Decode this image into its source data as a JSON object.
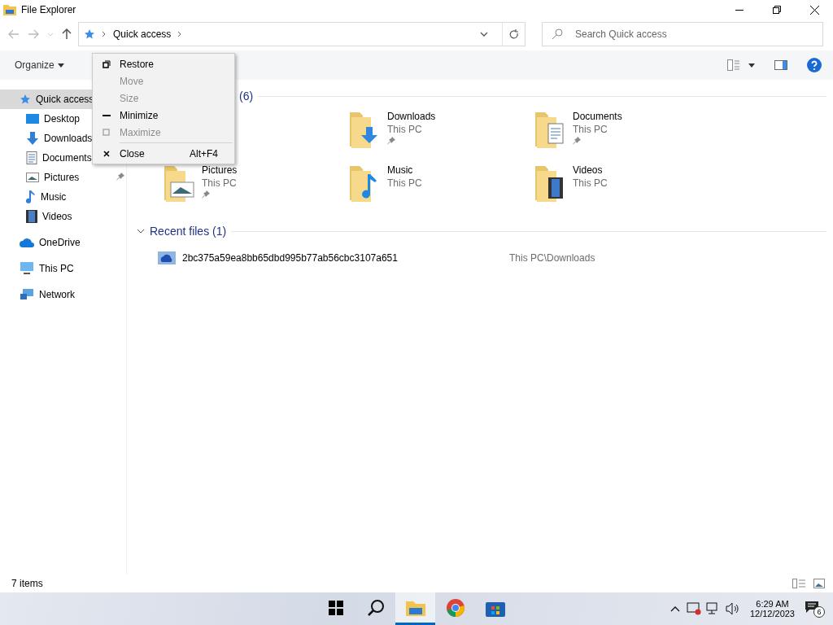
{
  "window": {
    "title": "File Explorer"
  },
  "address": {
    "segments": [
      "Quick access"
    ]
  },
  "search": {
    "placeholder": "Search Quick access"
  },
  "command_bar": {
    "organize": "Organize"
  },
  "sidebar": {
    "items": [
      {
        "label": "Quick access",
        "kind": "star",
        "selected": true,
        "children": [
          {
            "label": "Desktop",
            "kind": "desktop",
            "selected": false
          },
          {
            "label": "Downloads",
            "kind": "downloads",
            "selected": false
          },
          {
            "label": "Documents",
            "kind": "documents",
            "selected": false
          },
          {
            "label": "Pictures",
            "kind": "pictures",
            "selected": false,
            "pinned": true
          },
          {
            "label": "Music",
            "kind": "music",
            "selected": false
          },
          {
            "label": "Videos",
            "kind": "videos",
            "selected": false
          }
        ]
      },
      {
        "label": "OneDrive",
        "kind": "cloud",
        "selected": false
      },
      {
        "label": "This PC",
        "kind": "pc",
        "selected": false
      },
      {
        "label": "Network",
        "kind": "network",
        "selected": false
      }
    ]
  },
  "frequent_folders": {
    "header": "(6)",
    "folders": [
      {
        "name": "Downloads",
        "location": "This PC",
        "kind": "downloads",
        "pinned": true
      },
      {
        "name": "Documents",
        "location": "This PC",
        "kind": "documents",
        "pinned": true
      },
      {
        "name": "Pictures",
        "location": "This PC",
        "kind": "pictures",
        "pinned": true
      },
      {
        "name": "Music",
        "location": "This PC",
        "kind": "music",
        "pinned": false
      },
      {
        "name": "Videos",
        "location": "This PC",
        "kind": "videos",
        "pinned": false
      }
    ]
  },
  "recent_files": {
    "header": "Recent files (1)",
    "files": [
      {
        "name": "2bc375a59ea8bb65dbd995b77ab56cbc3107a651",
        "location": "This PC\\Downloads"
      }
    ]
  },
  "context_menu": {
    "items": [
      {
        "label": "Restore",
        "kind": "restore",
        "disabled": false
      },
      {
        "label": "Move",
        "kind": "none",
        "disabled": true
      },
      {
        "label": "Size",
        "kind": "none",
        "disabled": true
      },
      {
        "label": "Minimize",
        "kind": "minimize",
        "disabled": false
      },
      {
        "label": "Maximize",
        "kind": "maximize",
        "disabled": true
      },
      {
        "label": "Close",
        "kind": "close",
        "disabled": false,
        "shortcut": "Alt+F4"
      }
    ]
  },
  "status_bar": {
    "items": "7 items"
  },
  "taskbar": {
    "apps": [
      {
        "kind": "start",
        "active": false
      },
      {
        "kind": "search",
        "active": false
      },
      {
        "kind": "explorer",
        "active": true
      },
      {
        "kind": "chrome",
        "active": false
      },
      {
        "kind": "store",
        "active": false
      }
    ],
    "time": "6:29 AM",
    "date": "12/12/2023",
    "notifications": "6"
  }
}
